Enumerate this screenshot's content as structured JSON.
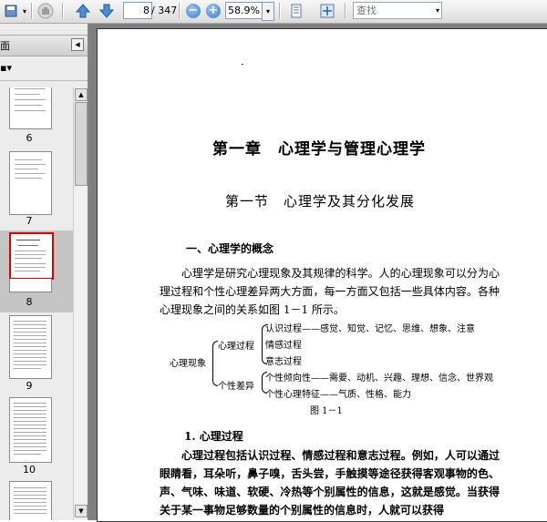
{
  "toolbar": {
    "page_current": "8",
    "page_total": "/ 347",
    "zoom_value": "58.9%",
    "search_placeholder": "查找"
  },
  "sidebar": {
    "title": "面",
    "thumbnails": [
      {
        "label": "6"
      },
      {
        "label": "7"
      },
      {
        "label": "8",
        "selected": true
      },
      {
        "label": "9"
      },
      {
        "label": "10"
      }
    ]
  },
  "document": {
    "chapter_title": "第一章　心理学与管理心理学",
    "section_title": "第一节　心理学及其分化发展",
    "heading1": "一、心理学的概念",
    "paragraph1": "心理学是研究心理现象及其规律的科学。人的心理现象可以分为心理过程和个性心理差异两大方面，每一方面又包括一些具体内容。各种心理现象之间的关系如图 1－1 所示。",
    "diagram": {
      "root": "心理现象",
      "branch1": "心理过程",
      "branch1_items": [
        "认识过程——感觉、知觉、记忆、思维、想象、注意",
        "情感过程",
        "意志过程"
      ],
      "branch2": "个性差异",
      "branch2_items": [
        "个性倾向性——需要、动机、兴趣、理想、信念、世界观",
        "个性心理特征——气质、性格、能力"
      ],
      "caption": "图 1－1"
    },
    "heading2": "1. 心理过程",
    "paragraph2": "心理过程包括认识过程、情感过程和意志过程。例如，人可以通过眼睛看，耳朵听，鼻子嗅，舌头尝，手触摸等途径获得客观事物的色、声、气味、味道、软硬、冷热等个别属性的信息，这就是感觉。当获得关于某一事物足够数量的个别属性的信息时，人就可以获得"
  }
}
